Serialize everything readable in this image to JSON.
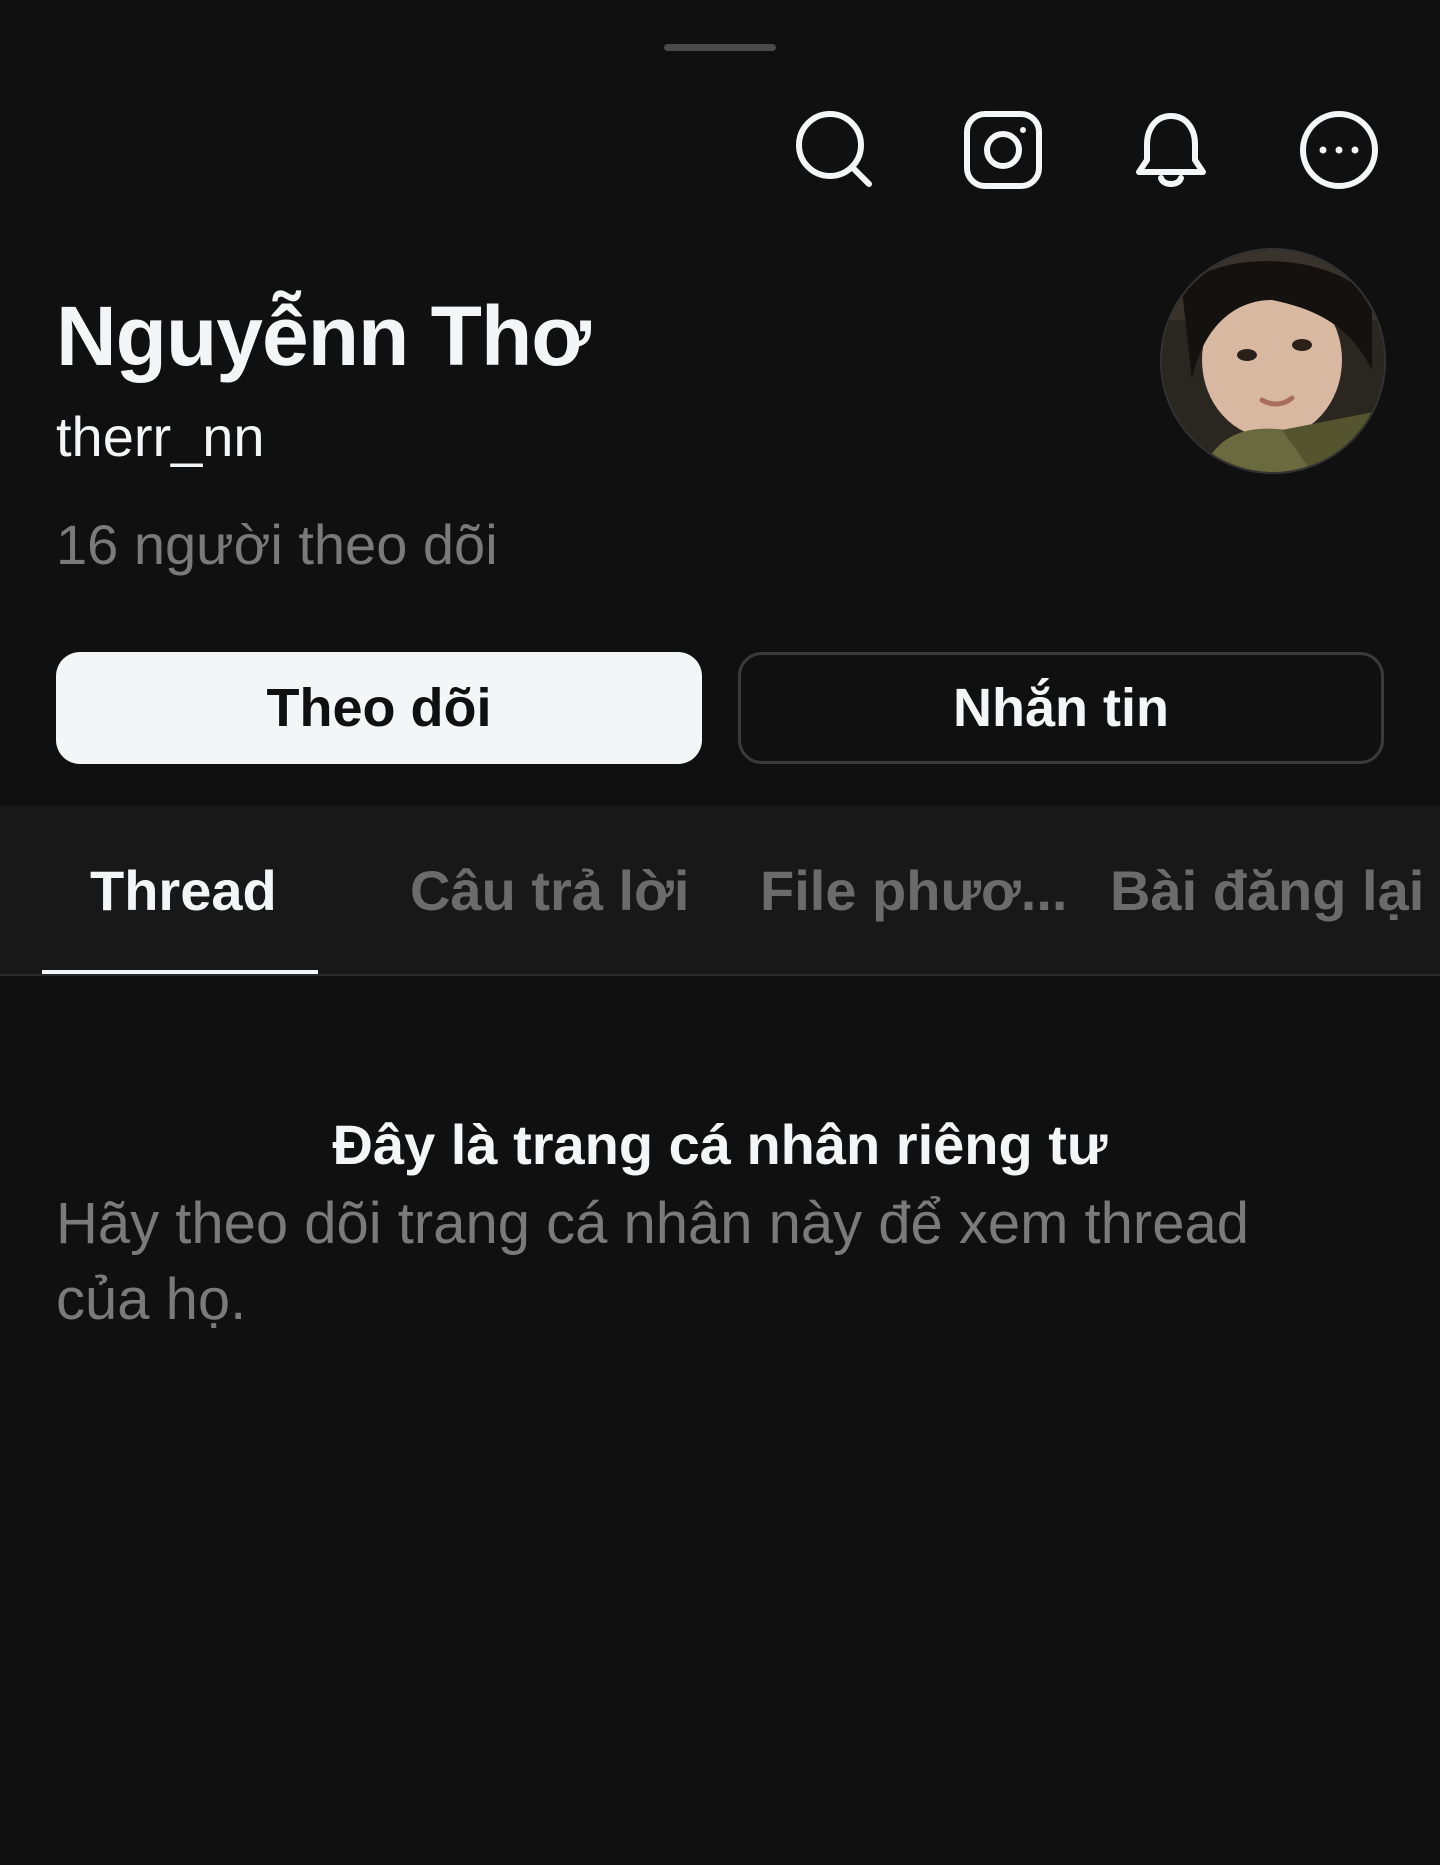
{
  "header": {
    "icons": [
      "search-icon",
      "instagram-icon",
      "bell-icon",
      "more-icon"
    ]
  },
  "profile": {
    "name": "Nguyễnn Thơ",
    "handle": "therr_nn",
    "followers": "16 người theo dõi"
  },
  "actions": {
    "follow_label": "Theo dõi",
    "message_label": "Nhắn tin"
  },
  "tabs": [
    {
      "label": "Thread",
      "active": true
    },
    {
      "label": "Câu trả lời",
      "active": false
    },
    {
      "label": "File phươ...",
      "active": false
    },
    {
      "label": "Bài đăng lại",
      "active": false
    }
  ],
  "empty_state": {
    "title": "Đây là trang cá nhân riêng tư",
    "message": "Hãy theo dõi trang cá nhân này để xem thread của họ."
  },
  "colors": {
    "background": "#101010",
    "tab_bar": "#181818",
    "primary_text": "#f3f5f7",
    "secondary_text": "#7a7a7a",
    "inactive_tab": "#6b6b6b"
  }
}
